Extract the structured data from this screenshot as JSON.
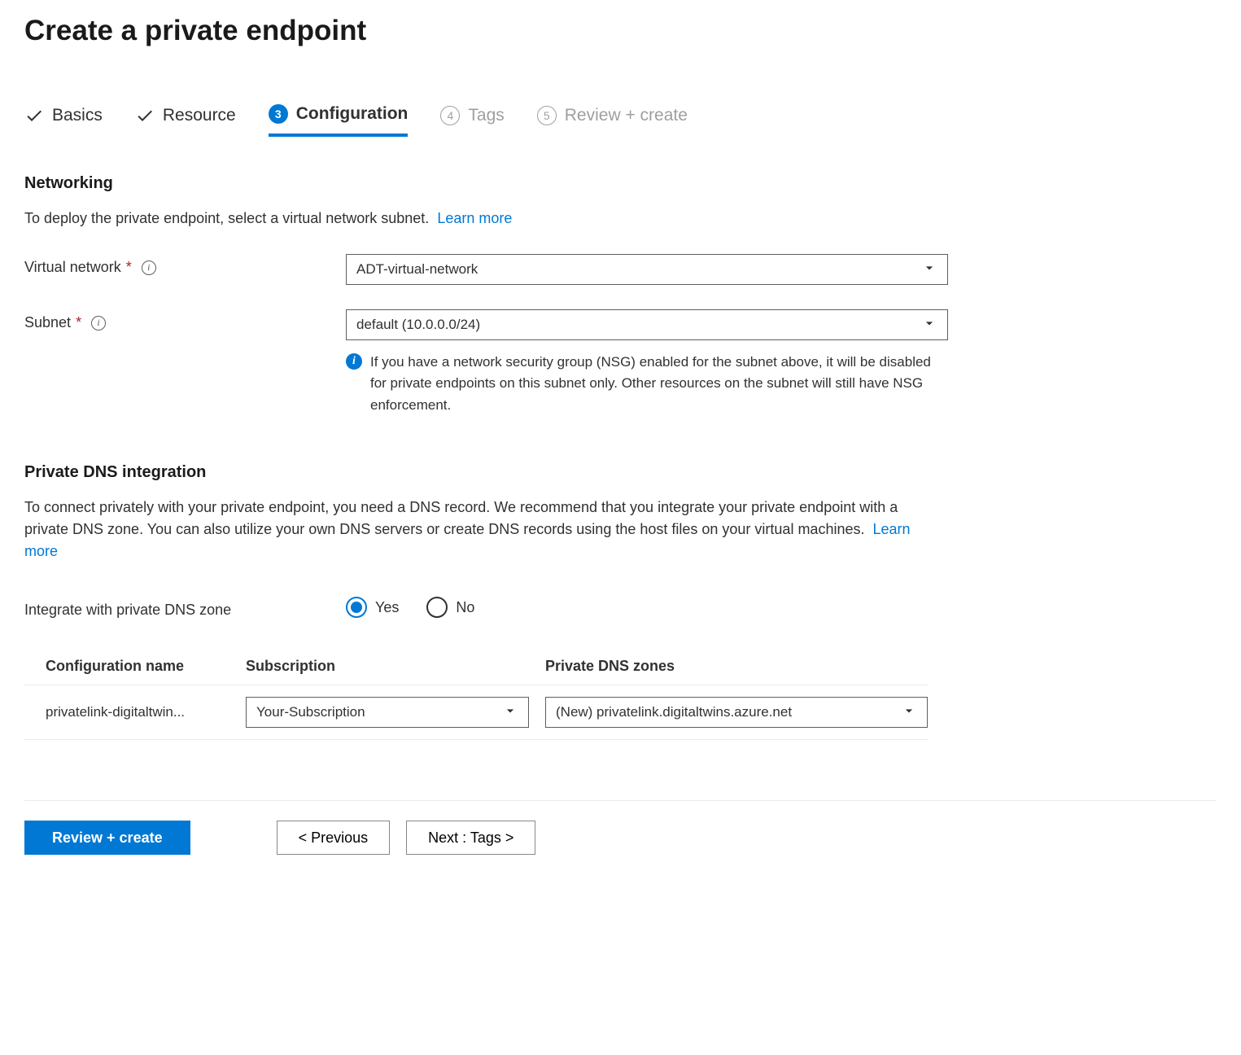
{
  "pageTitle": "Create a private endpoint",
  "tabs": [
    {
      "label": "Basics",
      "state": "done"
    },
    {
      "label": "Resource",
      "state": "done"
    },
    {
      "label": "Configuration",
      "state": "active",
      "num": "3"
    },
    {
      "label": "Tags",
      "state": "pending",
      "num": "4"
    },
    {
      "label": "Review + create",
      "state": "pending",
      "num": "5"
    }
  ],
  "networking": {
    "heading": "Networking",
    "desc": "To deploy the private endpoint, select a virtual network subnet.",
    "learnMore": "Learn more",
    "fields": {
      "vnet": {
        "label": "Virtual network",
        "required": true,
        "value": "ADT-virtual-network"
      },
      "subnet": {
        "label": "Subnet",
        "required": true,
        "value": "default (10.0.0.0/24)",
        "note": "If you have a network security group (NSG) enabled for the subnet above, it will be disabled for private endpoints on this subnet only. Other resources on the subnet will still have NSG enforcement."
      }
    }
  },
  "dns": {
    "heading": "Private DNS integration",
    "desc": "To connect privately with your private endpoint, you need a DNS record. We recommend that you integrate your private endpoint with a private DNS zone. You can also utilize your own DNS servers or create DNS records using the host files on your virtual machines.",
    "learnMore": "Learn more",
    "integrate": {
      "label": "Integrate with private DNS zone",
      "yes": "Yes",
      "no": "No",
      "selected": "yes"
    },
    "table": {
      "headers": {
        "config": "Configuration name",
        "sub": "Subscription",
        "zone": "Private DNS zones"
      },
      "row": {
        "config": "privatelink-digitaltwin...",
        "sub": "Your-Subscription",
        "zone": "(New) privatelink.digitaltwins.azure.net"
      }
    }
  },
  "footer": {
    "review": "Review + create",
    "prev": "< Previous",
    "next": "Next : Tags >"
  }
}
